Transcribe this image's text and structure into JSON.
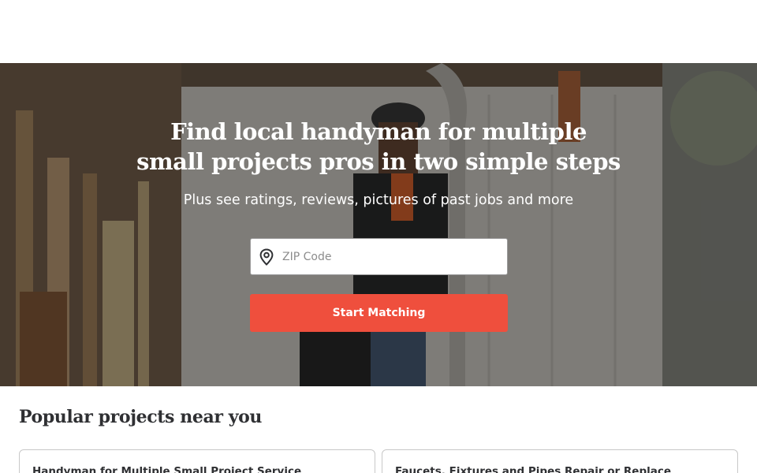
{
  "hero": {
    "title_line1": "Find local handyman for multiple",
    "title_line2": "small projects pros in two simple steps",
    "subtitle": "Plus see ratings, reviews, pictures of past jobs and more",
    "zip_placeholder": "ZIP Code",
    "cta_label": "Start Matching",
    "cta_color": "#ef4f3d",
    "pin_icon": "map-pin-icon"
  },
  "popular": {
    "title": "Popular projects near you",
    "cards": [
      {
        "title": "Handyman for Multiple Small Project Service"
      },
      {
        "title": "Faucets, Fixtures and Pipes Repair or Replace"
      }
    ]
  }
}
